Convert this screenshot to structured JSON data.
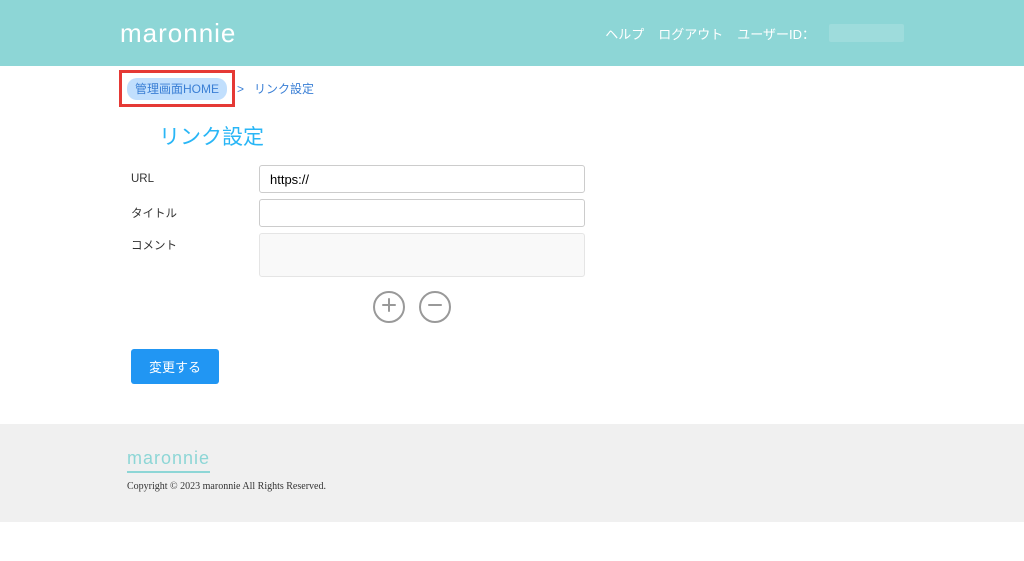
{
  "header": {
    "logo": "maronnie",
    "help": "ヘルプ",
    "logout": "ログアウト",
    "user_id_label": "ユーザーID："
  },
  "breadcrumb": {
    "home": "管理画面HOME",
    "sep": ">",
    "current": "リンク設定"
  },
  "page_title": "リンク設定",
  "form": {
    "url_label": "URL",
    "url_value": "https://",
    "title_label": "タイトル",
    "title_value": "",
    "comment_label": "コメント",
    "comment_value": ""
  },
  "submit": "変更する",
  "footer": {
    "logo": "maronnie",
    "copyright": "Copyright © 2023 maronnie All Rights Reserved."
  }
}
